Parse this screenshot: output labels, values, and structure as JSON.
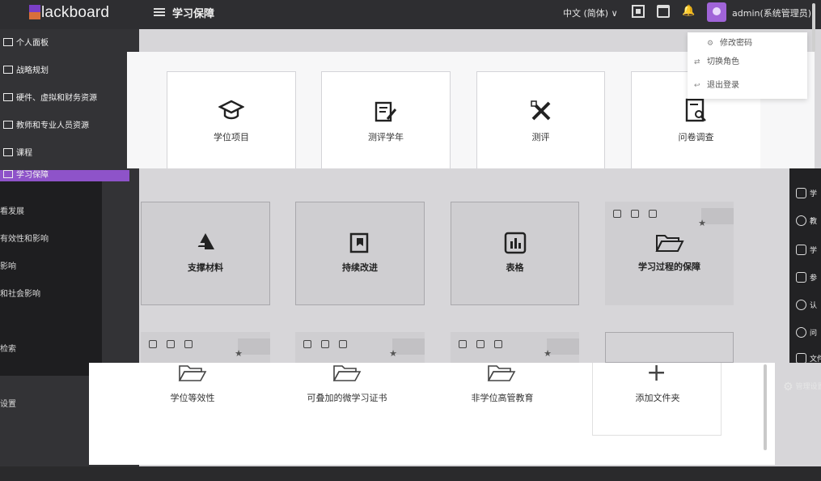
{
  "topbar": {
    "logo_text": "lackboard",
    "page_title": "学习保障",
    "language": "中文 (简体) ∨",
    "user_name": "admin(系统管理员)"
  },
  "sidebar": {
    "items": [
      {
        "label": "个人面板"
      },
      {
        "label": "战略规划"
      },
      {
        "label": "硬件、虚拟和财务资源"
      },
      {
        "label": "教师和专业人员资源"
      },
      {
        "label": "课程"
      },
      {
        "label": "学习保障"
      }
    ],
    "sub_items": [
      {
        "label": "看发展"
      },
      {
        "label": "有效性和影响"
      },
      {
        "label": "影响"
      },
      {
        "label": "和社会影响"
      },
      {
        "label": "检索"
      },
      {
        "label": "设置"
      }
    ]
  },
  "user_menu": {
    "items": [
      {
        "label": "修改密码",
        "icon": "gear-icon"
      },
      {
        "label": "切换角色",
        "icon": "switch-icon"
      },
      {
        "label": "退出登录",
        "icon": "logout-icon"
      }
    ]
  },
  "top_cards": [
    {
      "label": "学位项目",
      "icon": "graduation-cap-icon"
    },
    {
      "label": "测评学年",
      "icon": "edit-document-icon"
    },
    {
      "label": "测评",
      "icon": "ruler-pencil-icon"
    },
    {
      "label": "问卷调查",
      "icon": "document-search-icon"
    }
  ],
  "middle_cards": [
    {
      "label": "支撑材料",
      "icon": "layers-icon"
    },
    {
      "label": "持续改进",
      "icon": "bookmark-book-icon"
    },
    {
      "label": "表格",
      "icon": "bar-chart-icon"
    },
    {
      "label": "学习过程的保障",
      "icon": "folder-open-icon"
    }
  ],
  "folder_cards": [
    {
      "label": "学位等效性",
      "icon": "folder-open-icon"
    },
    {
      "label": "可叠加的微学习证书",
      "icon": "folder-open-icon"
    },
    {
      "label": "非学位高管教育",
      "icon": "folder-open-icon"
    }
  ],
  "add_folder": {
    "label": "添加文件夹",
    "icon": "plus-icon"
  },
  "right_strip": {
    "items": [
      {
        "label": "学"
      },
      {
        "label": "教"
      },
      {
        "label": "学"
      },
      {
        "label": "参"
      },
      {
        "label": "认"
      },
      {
        "label": "问"
      },
      {
        "label": "文件夹"
      }
    ],
    "manage_label": "管理设置"
  },
  "colors": {
    "accent": "#8e53c9",
    "topbar": "#2e2e31",
    "sidebar": "#333336"
  }
}
